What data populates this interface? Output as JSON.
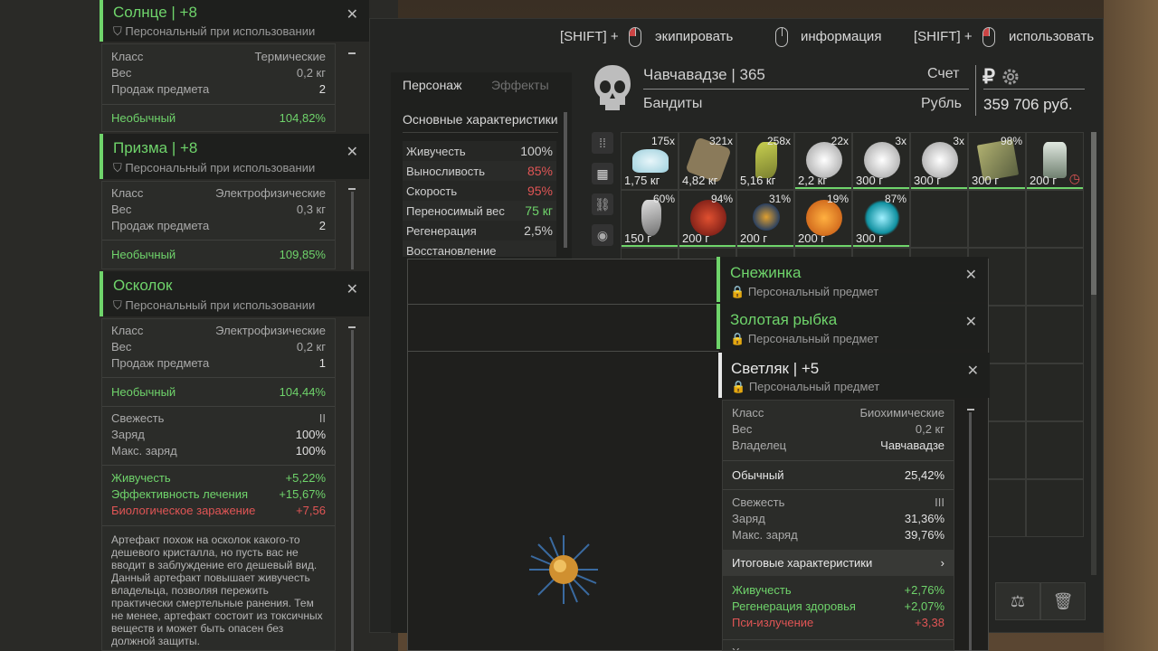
{
  "hints": [
    {
      "prefix": "[SHIFT] +",
      "label": "экипировать"
    },
    {
      "prefix": "",
      "label": "информация"
    },
    {
      "prefix": "[SHIFT] +",
      "label": "использовать"
    }
  ],
  "tabs": {
    "character": "Персонаж",
    "effects": "Эффекты"
  },
  "stats": {
    "title": "Основные характеристики",
    "rows": [
      {
        "label": "Живучесть",
        "value": "100%",
        "color": "normal"
      },
      {
        "label": "Выносливость",
        "value": "85%",
        "color": "red"
      },
      {
        "label": "Скорость",
        "value": "95%",
        "color": "red"
      },
      {
        "label": "Переносимый вес",
        "value": "75 кг",
        "color": "green"
      },
      {
        "label": "Регенерация",
        "value": "2,5%",
        "color": "normal"
      },
      {
        "label": "Восстановление",
        "value": "",
        "color": "normal"
      }
    ]
  },
  "character": {
    "name": "Чавчавадзе | 365",
    "faction": "Бандиты",
    "score_label": "Счет",
    "currency_label": "Рубль",
    "money": "359 706 руб.",
    "currency_symbol": "₽"
  },
  "inventory": [
    {
      "count": "175x",
      "weight": "1,75 кг",
      "color": "#cfe9ef"
    },
    {
      "count": "321x",
      "weight": "4,82 кг",
      "color": "#8a7a5a"
    },
    {
      "count": "258x",
      "weight": "5,16 кг",
      "color": "#a8b040"
    },
    {
      "count": "22x",
      "weight": "2,2 кг",
      "color": "#dcdcdc"
    },
    {
      "count": "3x",
      "weight": "300 г",
      "color": "#dcdcdc"
    },
    {
      "count": "3x",
      "weight": "300 г",
      "color": "#dcdcdc"
    },
    {
      "count": "98%",
      "weight": "300 г",
      "color": "#8a9060"
    },
    {
      "count": "",
      "weight": "200 г",
      "color": "#b0b8b0"
    },
    {
      "count": "60%",
      "weight": "150 г",
      "color": "#c0c0c0"
    },
    {
      "count": "94%",
      "weight": "200 г",
      "color": "#b03020"
    },
    {
      "count": "31%",
      "weight": "200 г",
      "color": "#c07020"
    },
    {
      "count": "19%",
      "weight": "200 г",
      "color": "#e08020"
    },
    {
      "count": "87%",
      "weight": "300 г",
      "color": "#30c0d0"
    }
  ],
  "tooltip_sun": {
    "title": "Солнце | +8",
    "sub": "Персональный при использовании",
    "class_label": "Класс",
    "class_value": "Термические",
    "weight_label": "Вес",
    "weight_value": "0,2 кг",
    "sell_label": "Продаж предмета",
    "sell_value": "2",
    "rarity": "Необычный",
    "rarity_value": "104,82%"
  },
  "tooltip_prism": {
    "title": "Призма | +8",
    "sub": "Персональный при использовании",
    "class_label": "Класс",
    "class_value": "Электрофизические",
    "weight_label": "Вес",
    "weight_value": "0,3 кг",
    "sell_label": "Продаж предмета",
    "sell_value": "2",
    "rarity": "Необычный",
    "rarity_value": "109,85%"
  },
  "tooltip_shard": {
    "title": "Осколок",
    "sub": "Персональный при использовании",
    "class_label": "Класс",
    "class_value": "Электрофизические",
    "weight_label": "Вес",
    "weight_value": "0,2 кг",
    "sell_label": "Продаж предмета",
    "sell_value": "1",
    "rarity": "Необычный",
    "rarity_value": "104,44%",
    "fresh_label": "Свежесть",
    "fresh_value": "II",
    "charge_label": "Заряд",
    "charge_value": "100%",
    "maxcharge_label": "Макс. заряд",
    "maxcharge_value": "100%",
    "effects": [
      {
        "label": "Живучесть",
        "value": "+5,22%",
        "color": "green"
      },
      {
        "label": "Эффективность лечения",
        "value": "+15,67%",
        "color": "green"
      },
      {
        "label": "Биологическое заражение",
        "value": "+7,56",
        "color": "red"
      }
    ],
    "desc": "Артефакт похож на осколок какого-то дешевого кристалла, но пусть вас не вводит в заблуждение его дешевый вид. Данный артефакт повышает живучесть владельца, позволяя пережить практически смертельные ранения. Тем не менее, артефакт состоит из токсичных веществ и может быть опасен без должной защиты."
  },
  "tooltip_snow": {
    "title": "Снежинка",
    "sub": "Персональный предмет"
  },
  "tooltip_fish": {
    "title": "Золотая рыбка",
    "sub": "Персональный предмет"
  },
  "tooltip_firefly": {
    "title": "Светляк | +5",
    "sub": "Персональный предмет",
    "class_label": "Класс",
    "class_value": "Биохимические",
    "weight_label": "Вес",
    "weight_value": "0,2 кг",
    "owner_label": "Владелец",
    "owner_value": "Чавчавадзе",
    "rarity": "Обычный",
    "rarity_value": "25,42%",
    "fresh_label": "Свежесть",
    "fresh_value": "III",
    "charge_label": "Заряд",
    "charge_value": "31,36%",
    "maxcharge_label": "Макс. заряд",
    "maxcharge_value": "39,76%",
    "summary_label": "Итоговые характеристики",
    "effects": [
      {
        "label": "Живучесть",
        "value": "+2,76%",
        "color": "green"
      },
      {
        "label": "Регенерация здоровья",
        "value": "+2,07%",
        "color": "green"
      },
      {
        "label": "Пси-излучение",
        "value": "+3,38",
        "color": "red"
      }
    ],
    "cut_label": "Характеристики заточки"
  },
  "colors": {
    "rarity_green": "#6fd46b",
    "negative_red": "#e05555"
  }
}
